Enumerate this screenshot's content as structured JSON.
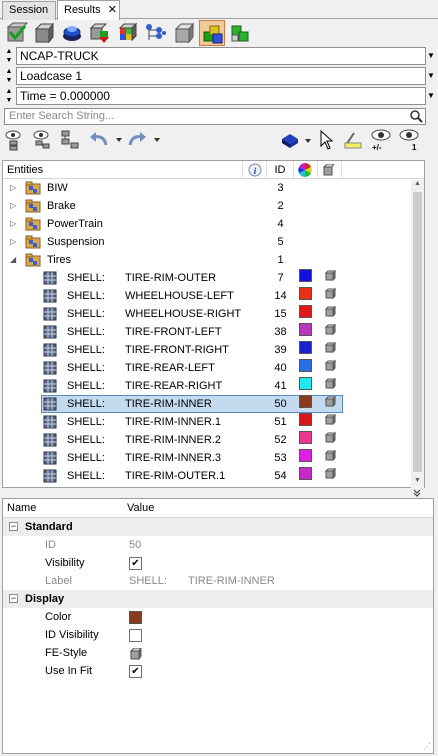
{
  "tabs": [
    {
      "label": "Session",
      "active": false
    },
    {
      "label": "Results",
      "active": true,
      "close": "✕"
    }
  ],
  "toolbar1": {
    "buttons": [
      "check-cube-icon",
      "cube-icon",
      "blue-stack-icon",
      "assembly-icon",
      "multicolor-cube-icon",
      "tree-graph-icon",
      "grey-cube-icon",
      "selected-parts-icon",
      "green-stack-icon"
    ],
    "active_index": 7
  },
  "combos": {
    "model": "NCAP-TRUCK",
    "loadcase": "Loadcase 1",
    "time": "Time = 0.000000"
  },
  "search": {
    "placeholder": "Enter Search String..."
  },
  "toolbar2": {
    "visibility_plus_minus_label": "+/-",
    "visibility_one_label": "1"
  },
  "tree": {
    "columns": {
      "entities": "Entities",
      "info": "i",
      "id": "ID"
    },
    "assemblies": [
      {
        "name": "BIW",
        "id": "3",
        "expanded": false
      },
      {
        "name": "Brake",
        "id": "2",
        "expanded": false
      },
      {
        "name": "PowerTrain",
        "id": "4",
        "expanded": false
      },
      {
        "name": "Suspension",
        "id": "5",
        "expanded": false
      },
      {
        "name": "Tires",
        "id": "1",
        "expanded": true
      }
    ],
    "parts": [
      {
        "type": "SHELL:",
        "name": "TIRE-RIM-OUTER",
        "id": "7",
        "color": "#1010d8",
        "selected": false
      },
      {
        "type": "SHELL:",
        "name": "WHEELHOUSE-LEFT",
        "id": "14",
        "color": "#e83018",
        "selected": false
      },
      {
        "type": "SHELL:",
        "name": "WHEELHOUSE-RIGHT",
        "id": "15",
        "color": "#e01818",
        "selected": false
      },
      {
        "type": "SHELL:",
        "name": "TIRE-FRONT-LEFT",
        "id": "38",
        "color": "#b838c0",
        "selected": false
      },
      {
        "type": "SHELL:",
        "name": "TIRE-FRONT-RIGHT",
        "id": "39",
        "color": "#1820d0",
        "selected": false
      },
      {
        "type": "SHELL:",
        "name": "TIRE-REAR-LEFT",
        "id": "40",
        "color": "#2870e0",
        "selected": false
      },
      {
        "type": "SHELL:",
        "name": "TIRE-REAR-RIGHT",
        "id": "41",
        "color": "#20e8f0",
        "selected": false
      },
      {
        "type": "SHELL:",
        "name": "TIRE-RIM-INNER",
        "id": "50",
        "color": "#8a3a1c",
        "selected": true
      },
      {
        "type": "SHELL:",
        "name": "TIRE-RIM-INNER.1",
        "id": "51",
        "color": "#d81818",
        "selected": false
      },
      {
        "type": "SHELL:",
        "name": "TIRE-RIM-INNER.2",
        "id": "52",
        "color": "#e83890",
        "selected": false
      },
      {
        "type": "SHELL:",
        "name": "TIRE-RIM-INNER.3",
        "id": "53",
        "color": "#e020e0",
        "selected": false
      },
      {
        "type": "SHELL:",
        "name": "TIRE-RIM-OUTER.1",
        "id": "54",
        "color": "#c828c8",
        "selected": false
      }
    ]
  },
  "properties": {
    "columns": {
      "name": "Name",
      "value": "Value"
    },
    "standard": {
      "title": "Standard",
      "id_label": "ID",
      "id_value": "50",
      "visibility_label": "Visibility",
      "visibility_checked": true,
      "label_label": "Label",
      "label_type": "SHELL:",
      "label_name": "TIRE-RIM-INNER"
    },
    "display": {
      "title": "Display",
      "color_label": "Color",
      "color_value": "#8a3a1c",
      "id_visibility_label": "ID Visibility",
      "id_visibility_checked": false,
      "fe_style_label": "FE-Style",
      "use_in_fit_label": "Use In Fit",
      "use_in_fit_checked": true
    }
  }
}
